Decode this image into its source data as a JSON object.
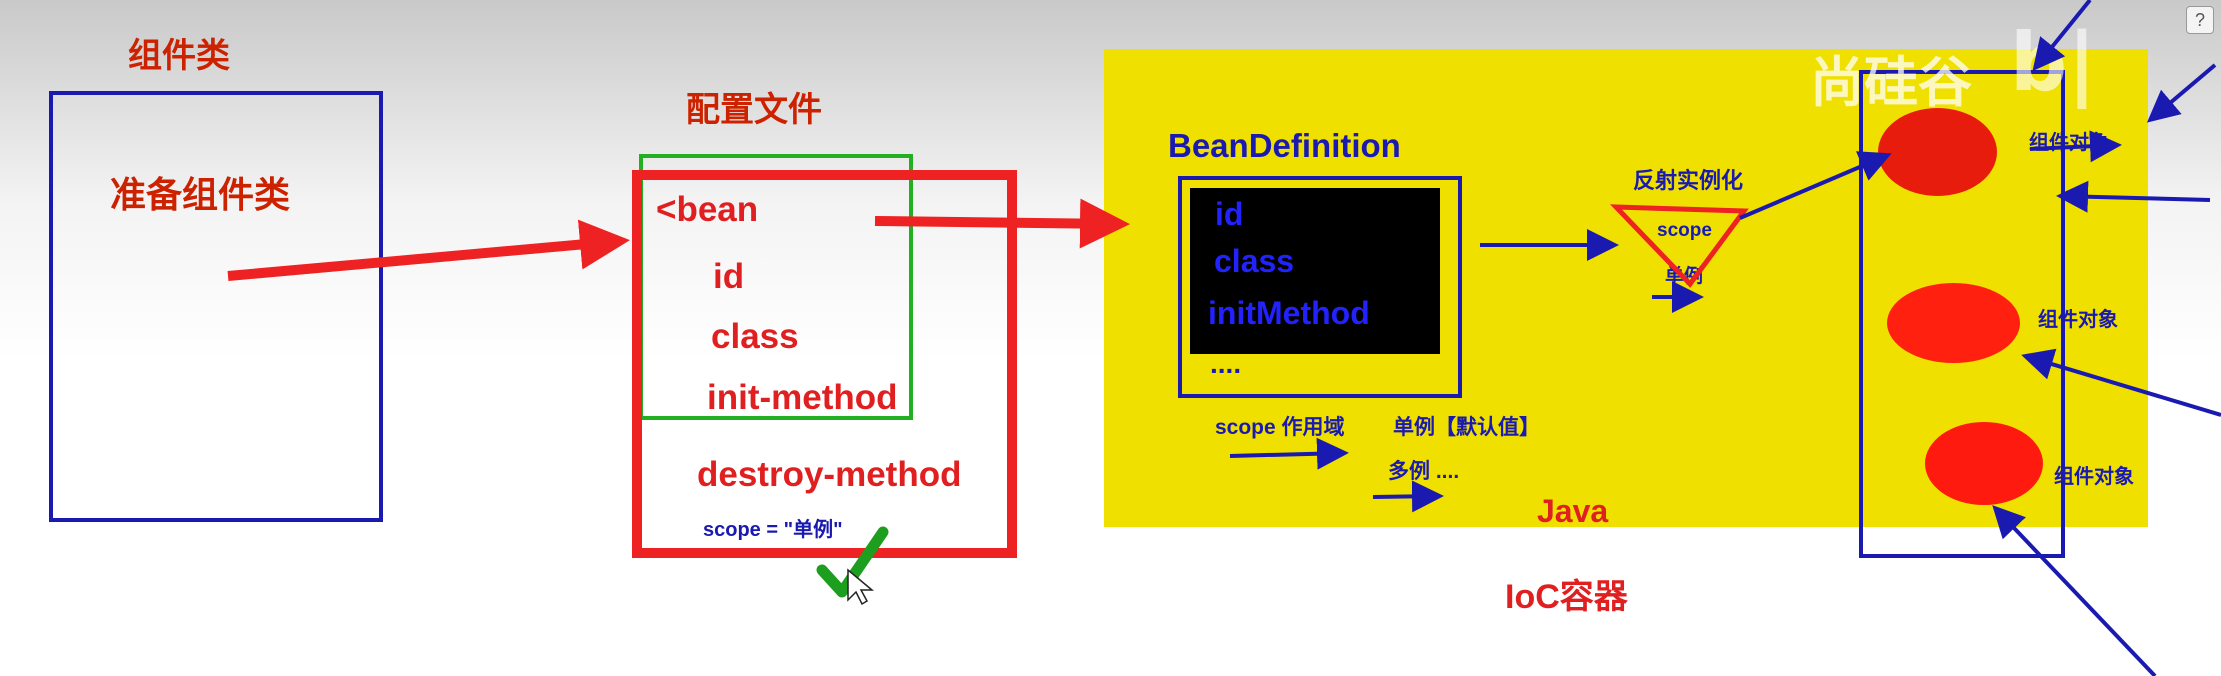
{
  "diagram": {
    "component_class_title": "组件类",
    "prepare_component_class": "准备组件类",
    "config_file_title": "配置文件",
    "bean_lines": [
      "<bean",
      "id",
      "class",
      "init-method",
      "destroy-method"
    ],
    "scope_line": "scope = \"单例\"",
    "bean_definition_title": "BeanDefinition",
    "bean_definition_fields": [
      "id",
      "class",
      "initMethod"
    ],
    "bean_definition_ellipsis": "....",
    "reflection_label": "反射实例化",
    "funnel_scope_label": "scope",
    "funnel_singleton_label": "单例",
    "scope_domain_label": "scope 作用域",
    "singleton_default_label": "单例【默认值】",
    "prototype_label": "多例 ....",
    "java_label": "Java",
    "ioc_container_label": "IoC容器",
    "component_objects": [
      "组件对象",
      "组件对象",
      "组件对象"
    ],
    "watermark_text": "尚硅谷",
    "help_icon_label": "?"
  },
  "colors": {
    "red": "#e02020",
    "blue": "#1a1ab0",
    "yellow": "#f0e000",
    "green": "#22b022",
    "black": "#000000"
  }
}
